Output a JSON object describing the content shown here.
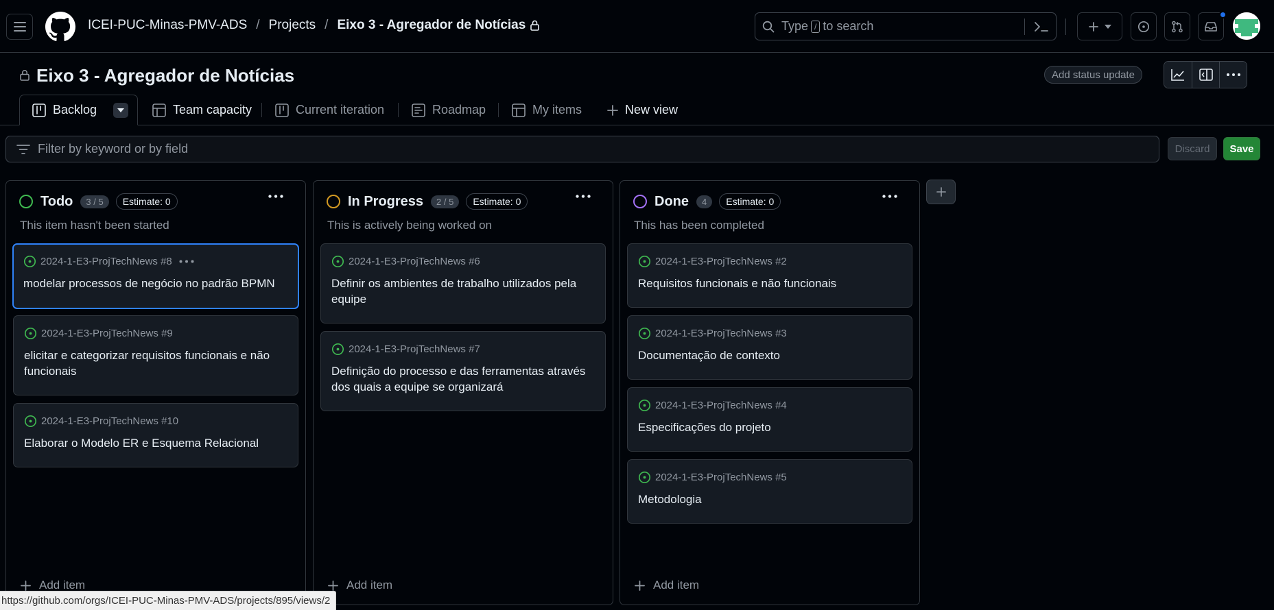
{
  "header": {
    "breadcrumb": {
      "org": "ICEI-PUC-Minas-PMV-ADS",
      "projects": "Projects",
      "current": "Eixo 3 - Agregador de Notícias",
      "separator": "/"
    },
    "search": {
      "text_before": "Type",
      "shortcut": "/",
      "text_after": "to search"
    },
    "icons": [
      "hamburger-menu-icon",
      "github-logo-icon",
      "search-icon",
      "command-palette-icon",
      "plus-icon",
      "chevron-down-icon",
      "issue-icon",
      "pull-request-icon",
      "inbox-icon",
      "avatar"
    ]
  },
  "project": {
    "title": "Eixo 3 - Agregador de Notícias",
    "add_status_update": "Add status update"
  },
  "tabs": [
    {
      "label": "Backlog",
      "icon": "board-icon",
      "active": true
    },
    {
      "label": "Team capacity",
      "icon": "table-icon"
    },
    {
      "label": "Current iteration",
      "icon": "board-icon"
    },
    {
      "label": "Roadmap",
      "icon": "roadmap-icon"
    },
    {
      "label": "My items",
      "icon": "table-icon"
    },
    {
      "label": "New view",
      "icon": "plus-icon"
    }
  ],
  "filter": {
    "placeholder": "Filter by keyword or by field",
    "discard": "Discard",
    "save": "Save"
  },
  "columns": [
    {
      "name": "Todo",
      "count": "3 / 5",
      "estimate": "Estimate: 0",
      "description": "This item hasn't been started",
      "color": "#3fb950",
      "add_item": "Add item",
      "cards": [
        {
          "ref": "2024-1-E3-ProjTechNews #8",
          "title": "modelar processos de negócio no padrão BPMN"
        },
        {
          "ref": "2024-1-E3-ProjTechNews #9",
          "title": "elicitar e categorizar requisitos funcionais e não funcionais"
        },
        {
          "ref": "2024-1-E3-ProjTechNews #10",
          "title": "Elaborar o Modelo ER e Esquema Relacional"
        }
      ]
    },
    {
      "name": "In Progress",
      "count": "2 / 5",
      "estimate": "Estimate: 0",
      "description": "This is actively being worked on",
      "color": "#d29922",
      "add_item": "Add item",
      "cards": [
        {
          "ref": "2024-1-E3-ProjTechNews #6",
          "title": "Definir os ambientes de trabalho utilizados pela equipe"
        },
        {
          "ref": "2024-1-E3-ProjTechNews #7",
          "title": "Definição do processo e das ferramentas através dos quais a equipe se organizará"
        }
      ]
    },
    {
      "name": "Done",
      "count": "4",
      "estimate": "Estimate: 0",
      "description": "This has been completed",
      "color": "#a371f7",
      "add_item": "Add item",
      "cards": [
        {
          "ref": "2024-1-E3-ProjTechNews #2",
          "title": "Requisitos funcionais e não funcionais"
        },
        {
          "ref": "2024-1-E3-ProjTechNews #3",
          "title": "Documentação de contexto"
        },
        {
          "ref": "2024-1-E3-ProjTechNews #4",
          "title": "Especificações do projeto"
        },
        {
          "ref": "2024-1-E3-ProjTechNews #5",
          "title": "Metodologia"
        }
      ]
    }
  ],
  "status_url": "https://github.com/orgs/ICEI-PUC-Minas-PMV-ADS/projects/895/views/2",
  "colors": {
    "background": "#010409",
    "card": "#151b23",
    "border": "#30363d",
    "accent_blue": "#2f81f7",
    "save_green": "#238636",
    "issue_open": "#3fb950"
  }
}
